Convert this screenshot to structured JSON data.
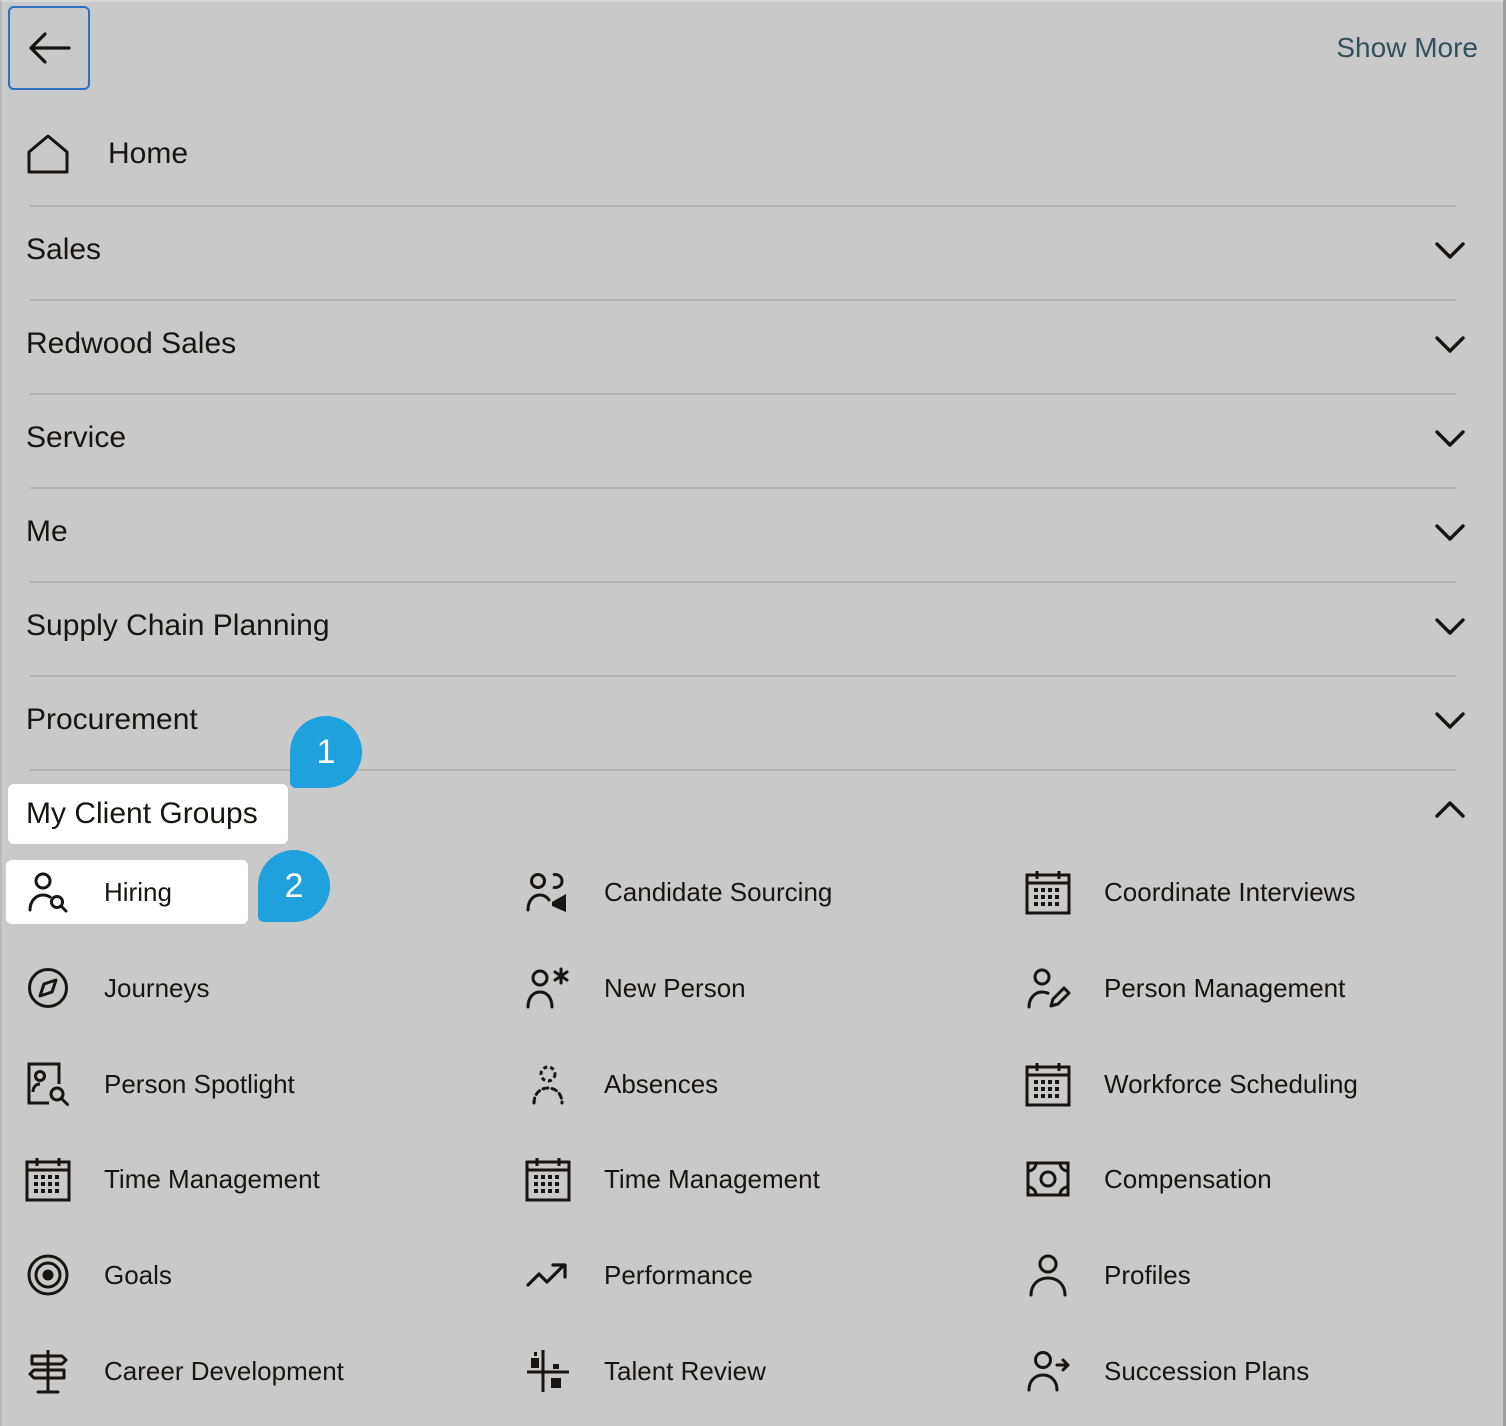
{
  "header": {
    "back_label": "Back",
    "show_more": "Show More"
  },
  "home": {
    "label": "Home"
  },
  "nav": [
    {
      "label": "Sales",
      "icon": "chevron-down-icon"
    },
    {
      "label": "Redwood Sales",
      "icon": "chevron-down-icon"
    },
    {
      "label": "Service",
      "icon": "chevron-down-icon"
    },
    {
      "label": "Me",
      "icon": "chevron-down-icon"
    },
    {
      "label": "Supply Chain Planning",
      "icon": "chevron-down-icon"
    },
    {
      "label": "Procurement",
      "icon": "chevron-down-icon"
    }
  ],
  "group": {
    "label": "My Client Groups",
    "icon": "chevron-up-icon"
  },
  "callouts": {
    "one": "1",
    "two": "2"
  },
  "tiles": [
    {
      "label": "Hiring",
      "icon": "person-search-icon"
    },
    {
      "label": "Candidate Sourcing",
      "icon": "people-megaphone-icon"
    },
    {
      "label": "Coordinate Interviews",
      "icon": "calendar-icon"
    },
    {
      "label": "Journeys",
      "icon": "compass-icon"
    },
    {
      "label": "New Person",
      "icon": "person-asterisk-icon"
    },
    {
      "label": "Person Management",
      "icon": "person-edit-icon"
    },
    {
      "label": "Person Spotlight",
      "icon": "document-person-search-icon"
    },
    {
      "label": "Absences",
      "icon": "person-absent-icon"
    },
    {
      "label": "Workforce Scheduling",
      "icon": "calendar-icon"
    },
    {
      "label": "Time Management",
      "icon": "calendar-icon"
    },
    {
      "label": "Time Management",
      "icon": "calendar-icon"
    },
    {
      "label": "Compensation",
      "icon": "money-icon"
    },
    {
      "label": "Goals",
      "icon": "target-icon"
    },
    {
      "label": "Performance",
      "icon": "trend-up-icon"
    },
    {
      "label": "Profiles",
      "icon": "person-icon"
    },
    {
      "label": "Career Development",
      "icon": "signpost-icon"
    },
    {
      "label": "Talent Review",
      "icon": "talent-grid-icon"
    },
    {
      "label": "Succession Plans",
      "icon": "person-arrow-icon"
    }
  ]
}
